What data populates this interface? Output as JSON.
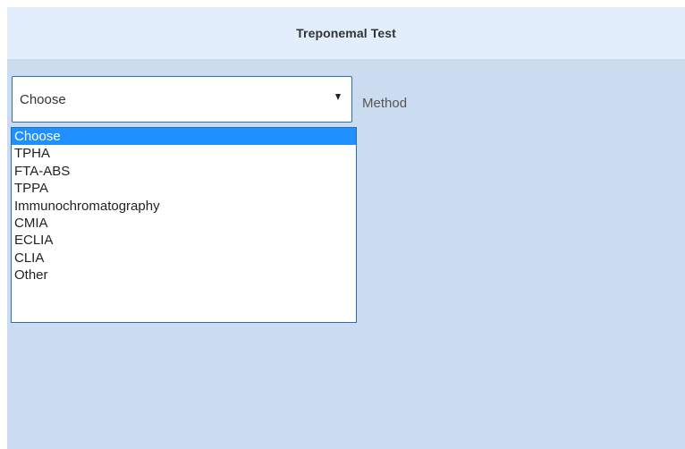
{
  "header": {
    "title": "Treponemal Test"
  },
  "method_field": {
    "label": "Method",
    "selected_value": "Choose",
    "options": [
      {
        "label": "Choose",
        "selected": true
      },
      {
        "label": "TPHA",
        "selected": false
      },
      {
        "label": "FTA-ABS",
        "selected": false
      },
      {
        "label": "TPPA",
        "selected": false
      },
      {
        "label": "Immunochromatography",
        "selected": false
      },
      {
        "label": "CMIA",
        "selected": false
      },
      {
        "label": "ECLIA",
        "selected": false
      },
      {
        "label": "CLIA",
        "selected": false
      },
      {
        "label": "Other",
        "selected": false
      }
    ]
  },
  "colors": {
    "panel_background": "#cbdcf1",
    "header_background": "#e2eefb",
    "select_border": "#2d6ea8",
    "highlight": "#1e90ff"
  },
  "icons": {
    "dropdown_arrow": "caret-down-icon"
  }
}
